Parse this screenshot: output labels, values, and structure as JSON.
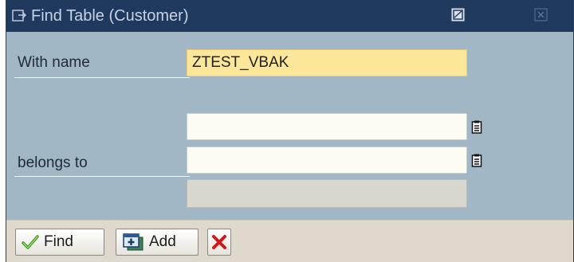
{
  "window": {
    "title": "Find Table (Customer)"
  },
  "form": {
    "name_label": "With name",
    "name_value": "ZTEST_VBAK",
    "belongs_to_label": "belongs to",
    "belongs_to_value1": "",
    "belongs_to_value2": "",
    "description_value": ""
  },
  "toolbar": {
    "find_label": "Find",
    "add_label": "Add"
  },
  "colors": {
    "title_bar": "#203a5f",
    "dialog_body": "#a1b7c6",
    "highlight_field": "#fbe69a",
    "toolbar": "#ded9cc",
    "cancel_red": "#d41818",
    "check_green": "#3c9a1e"
  },
  "icons": {
    "window_icon": "window-icon",
    "generate_screenshot": "screenshot-icon",
    "close": "close-icon",
    "value_help": "value-help-icon",
    "find": "check-icon",
    "add": "add-icon",
    "cancel": "cancel-icon"
  }
}
